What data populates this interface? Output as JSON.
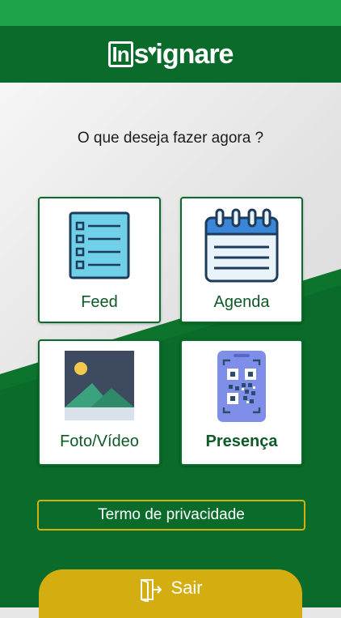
{
  "header": {
    "logo_text": "Insignare",
    "logo_in": "In",
    "logo_heart": "♥",
    "logo_rest": "ignare"
  },
  "prompt": "O que deseja fazer agora ?",
  "cards": [
    {
      "label": "Feed",
      "icon": "list-document-icon"
    },
    {
      "label": "Agenda",
      "icon": "calendar-icon"
    },
    {
      "label": "Foto/Vídeo",
      "icon": "image-gallery-icon"
    },
    {
      "label": "Presença",
      "icon": "qr-code-phone-icon"
    }
  ],
  "privacy_label": "Termo de privacidade",
  "exit_label": "Sair",
  "colors": {
    "header": "#0a6b2a",
    "status_bar": "#1fa34a",
    "accent": "#d4ad10"
  }
}
